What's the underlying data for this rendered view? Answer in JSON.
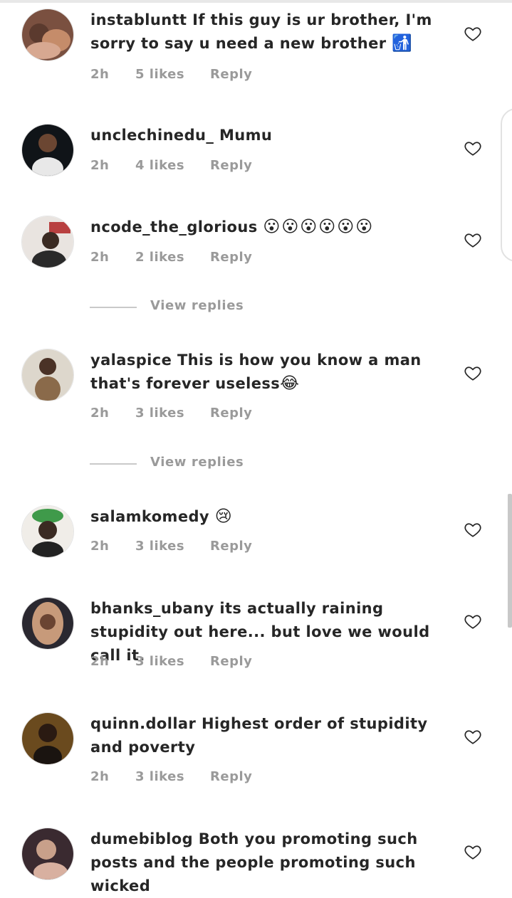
{
  "view_replies_label": "View replies",
  "comments": [
    {
      "username": "instabluntt",
      "text": " If this guy is ur brother, I'm sorry to say u need a new brother ",
      "emoji": "🚮",
      "time": "2h",
      "likes": "5 likes",
      "reply": "Reply"
    },
    {
      "username": "unclechinedu_",
      "text": " Mumu",
      "emoji": "",
      "time": "2h",
      "likes": "4 likes",
      "reply": "Reply"
    },
    {
      "username": "ncode_the_glorious",
      "text": " ",
      "emoji": "😮😮😮😮😮😮",
      "time": "2h",
      "likes": "2 likes",
      "reply": "Reply"
    },
    {
      "username": "yalaspice",
      "text": " This is how you know a man that's forever useless",
      "emoji": "😂",
      "time": "2h",
      "likes": "3 likes",
      "reply": "Reply"
    },
    {
      "username": "salamkomedy",
      "text": " ",
      "emoji": "😢",
      "time": "2h",
      "likes": "3 likes",
      "reply": "Reply"
    },
    {
      "username": "bhanks_ubany",
      "text": " its actually raining stupidity out here... but love we would call it.",
      "emoji": "",
      "time": "2h",
      "likes": "3 likes",
      "reply": "Reply"
    },
    {
      "username": "quinn.dollar",
      "text": " Highest order of stupidity and poverty",
      "emoji": "",
      "time": "2h",
      "likes": "3 likes",
      "reply": "Reply"
    },
    {
      "username": "dumebiblog",
      "text": " Both you promoting such posts and the people promoting such wicked",
      "emoji": "",
      "time": "",
      "likes": "",
      "reply": ""
    }
  ],
  "colors": {
    "text": "#262626",
    "meta": "#9a9a9a",
    "divider": "#c9c9c9"
  }
}
